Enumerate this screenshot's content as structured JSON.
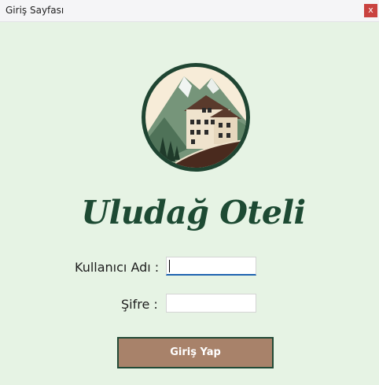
{
  "window": {
    "title": "Giriş Sayfası",
    "close_glyph": "x"
  },
  "logo": {
    "icon": "mountain-hotel-logo",
    "colors": {
      "ring": "#1f4532",
      "sky": "#f7ecd8",
      "mountain": "#76957a",
      "house": "#efe3cd",
      "roof": "#5a3a2c",
      "ground": "#4a2a1e"
    }
  },
  "heading": "Uludağ Oteli",
  "form": {
    "username_label": "Kullanıcı Adı :",
    "username_value": "",
    "password_label": "Şifre :",
    "password_value": "",
    "login_button": "Giriş Yap"
  },
  "colors": {
    "background": "#e6f3e4",
    "title_color": "#1d4a33",
    "button_bg": "#a8826a",
    "button_border": "#224a36",
    "close_bg": "#c9423f"
  }
}
